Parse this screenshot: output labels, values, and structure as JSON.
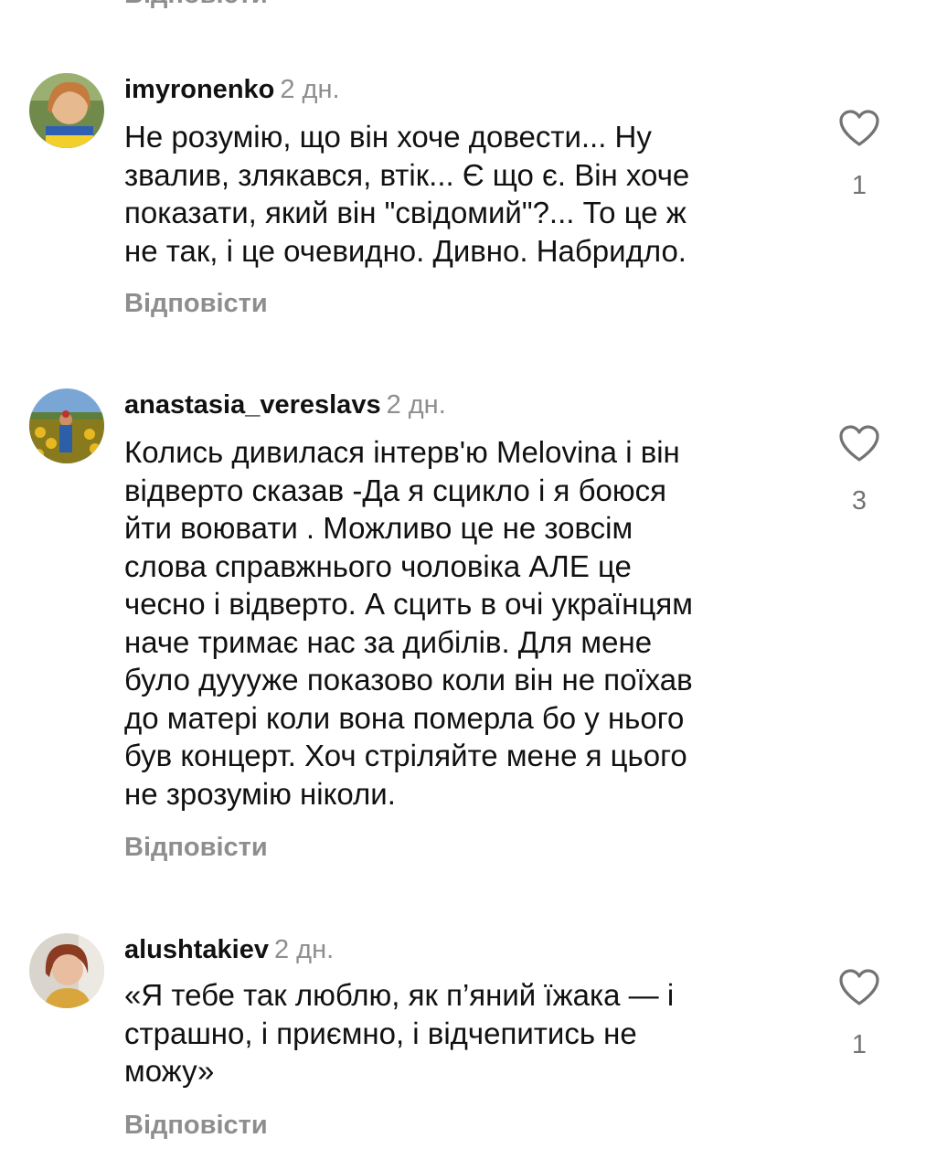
{
  "top_reply_label": "Відповісти",
  "comments": [
    {
      "username": "imyronenko",
      "time": "2 дн.",
      "lines": [
        "Не розумію, що він хоче довести... Ну",
        "звалив, злякався, втік... Є що є.  Він хоче",
        "показати, який він \"свідомий\"?... То це ж",
        "не так, і це очевидно. Дивно. Набридло."
      ],
      "likes": "1",
      "reply_label": "Відповісти"
    },
    {
      "username": "anastasia_vereslavs",
      "time": "2 дн.",
      "lines": [
        "Колись дивилася інтерв'ю Melovina і він",
        "відверто сказав -Да я сцикло і я боюся",
        "йти воювати . Можливо це не зовсім",
        "слова справжнього чоловіка АЛЕ це",
        "чесно і відверто. А сцить в очі українцям",
        "наче тримає нас за дибілів. Для мене",
        "було дуууже показово коли він не поїхав",
        "до матері коли вона померла бо у нього",
        "був концерт. Хоч стріляйте мене я цього",
        "не зрозумію ніколи."
      ],
      "likes": "3",
      "reply_label": "Відповісти"
    },
    {
      "username": "alushtakiev",
      "time": "2 дн.",
      "lines": [
        "«Я тебе так люблю, як п’яний їжака — і",
        "страшно, і приємно, і відчепитись не",
        "можу»"
      ],
      "likes": "1",
      "reply_label": "Відповісти"
    }
  ]
}
